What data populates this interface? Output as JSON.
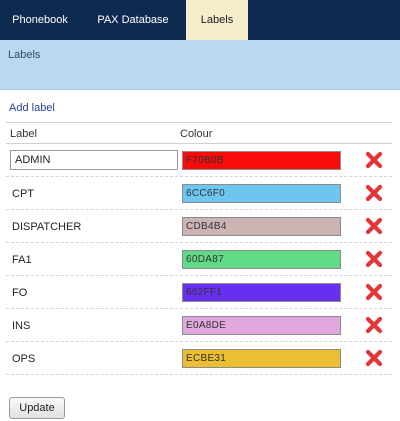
{
  "tabs": {
    "phonebook": "Phonebook",
    "pax": "PAX Database",
    "labels": "Labels"
  },
  "subheader": {
    "title": "Labels"
  },
  "add_label": "Add label",
  "columns": {
    "label": "Label",
    "colour": "Colour"
  },
  "rows": [
    {
      "label": "ADMIN",
      "colour": "F70B0B",
      "hex": "#F70B0B",
      "editing": true
    },
    {
      "label": "CPT",
      "colour": "6CC6F0",
      "hex": "#6CC6F0",
      "editing": false
    },
    {
      "label": "DISPATCHER",
      "colour": "CDB4B4",
      "hex": "#CDB4B4",
      "editing": false
    },
    {
      "label": "FA1",
      "colour": "60DA87",
      "hex": "#60DA87",
      "editing": false
    },
    {
      "label": "FO",
      "colour": "662FF1",
      "hex": "#662FF1",
      "editing": false
    },
    {
      "label": "INS",
      "colour": "E0A8DE",
      "hex": "#E0A8DE",
      "editing": false
    },
    {
      "label": "OPS",
      "colour": "ECBE31",
      "hex": "#ECBE31",
      "editing": false
    }
  ],
  "delete_icon": "x-delete-icon",
  "update_button": "Update",
  "colors": {
    "tabbar": "#0f2a50",
    "active_tab": "#f6edcd",
    "subheader": "#bcd8f1",
    "link": "#2a3f9a",
    "delete": "#e3363a"
  }
}
